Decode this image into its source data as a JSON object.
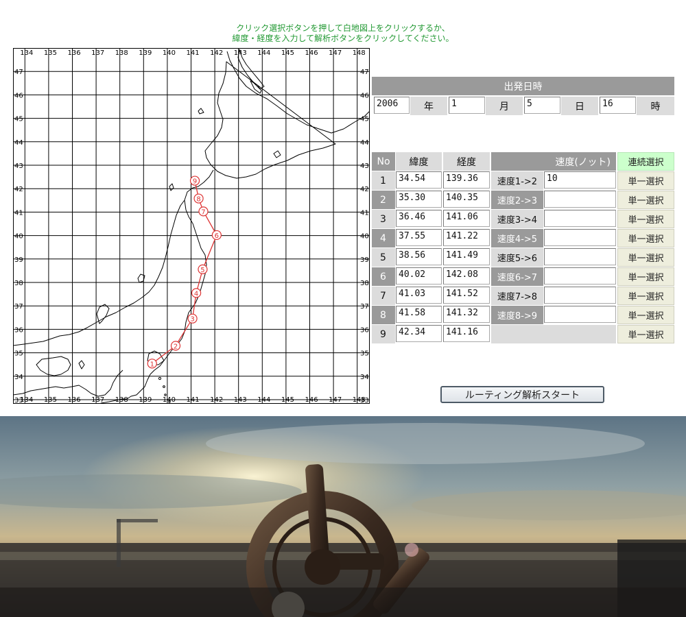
{
  "instructions": {
    "line1": "クリック選択ボタンを押して白地図上をクリックするか、",
    "line2": "緯度・経度を入力して解析ボタンをクリックしてください。"
  },
  "map": {
    "lon_labels": [
      "134",
      "135",
      "136",
      "137",
      "138",
      "139",
      "140",
      "141",
      "142",
      "143",
      "144",
      "145",
      "146",
      "147",
      "148"
    ],
    "lat_labels": [
      "47",
      "46",
      "45",
      "44",
      "43",
      "42",
      "41",
      "40",
      "39",
      "38",
      "37",
      "36",
      "35",
      "34",
      "33"
    ],
    "route_labels": [
      "1",
      "2",
      "3",
      "4",
      "5",
      "6",
      "7",
      "8",
      "9"
    ],
    "route_color": "#dd3333"
  },
  "departure": {
    "header": "出発日時",
    "year_value": "2006",
    "year_label": "年",
    "month_value": "1",
    "month_label": "月",
    "day_value": "5",
    "day_label": "日",
    "hour_value": "16",
    "hour_label": "時"
  },
  "table": {
    "col_no": "No",
    "col_lat": "緯度",
    "col_lon": "経度",
    "col_speed": "速度(ノット)",
    "continuous_button": "連続選択",
    "rows": [
      {
        "no": "1",
        "lat": "34.54",
        "lon": "139.36",
        "seg": "速度1->2",
        "speed": "10",
        "button": "単一選択"
      },
      {
        "no": "2",
        "lat": "35.30",
        "lon": "140.35",
        "seg": "速度2->3",
        "speed": "",
        "button": "単一選択"
      },
      {
        "no": "3",
        "lat": "36.46",
        "lon": "141.06",
        "seg": "速度3->4",
        "speed": "",
        "button": "単一選択"
      },
      {
        "no": "4",
        "lat": "37.55",
        "lon": "141.22",
        "seg": "速度4->5",
        "speed": "",
        "button": "単一選択"
      },
      {
        "no": "5",
        "lat": "38.56",
        "lon": "141.49",
        "seg": "速度5->6",
        "speed": "",
        "button": "単一選択"
      },
      {
        "no": "6",
        "lat": "40.02",
        "lon": "142.08",
        "seg": "速度6->7",
        "speed": "",
        "button": "単一選択"
      },
      {
        "no": "7",
        "lat": "41.03",
        "lon": "141.52",
        "seg": "速度7->8",
        "speed": "",
        "button": "単一選択"
      },
      {
        "no": "8",
        "lat": "41.58",
        "lon": "141.32",
        "seg": "速度8->9",
        "speed": "",
        "button": "単一選択"
      },
      {
        "no": "9",
        "lat": "42.34",
        "lon": "141.16",
        "seg": "",
        "speed": "",
        "button": "単一選択"
      }
    ]
  },
  "start_button": "ルーティング解析スタート"
}
